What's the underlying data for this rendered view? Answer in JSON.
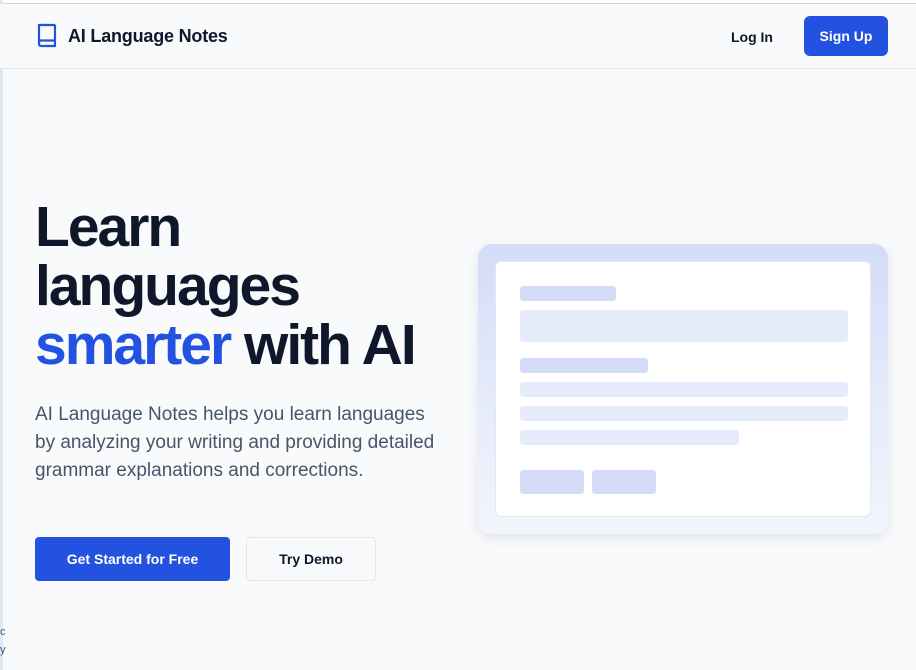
{
  "app": {
    "title": "AI Language Notes",
    "accent_color": "#2452e0"
  },
  "header": {
    "brand_icon": "book-icon",
    "login_label": "Log In",
    "signup_label": "Sign Up"
  },
  "hero": {
    "headline_line1": "Learn",
    "headline_line2": "languages",
    "headline_accent": "smarter",
    "headline_tail": " with AI",
    "description": "AI Language Notes helps you learn languages by analyzing your writing and providing detailed grammar explanations and corrections.",
    "primary_cta": "Get Started for Free",
    "secondary_cta": "Try Demo"
  },
  "edge_fragments": [
    "c",
    "y"
  ]
}
